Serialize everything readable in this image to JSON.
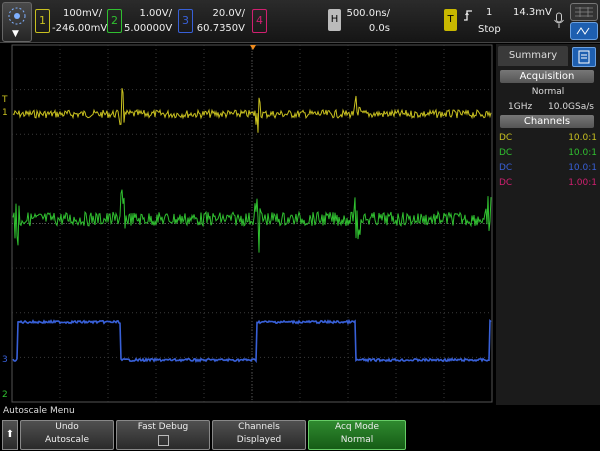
{
  "top": {
    "menu_chevron": "▼",
    "ch1": {
      "num": "1",
      "scale": "100mV/",
      "offset": "-246.00mV",
      "color": "#c8c020"
    },
    "ch2": {
      "num": "2",
      "scale": "1.00V/",
      "offset": "5.00000V",
      "color": "#30c030"
    },
    "ch3": {
      "num": "3",
      "scale": "20.0V/",
      "offset": "60.7350V",
      "color": "#3860d8"
    },
    "ch4": {
      "num": "4",
      "color": "#d02070"
    },
    "horiz": {
      "label": "H",
      "scale": "500.0ns/",
      "delay": "0.0s"
    },
    "trigger": {
      "label": "T",
      "channel": "1",
      "level": "14.3mV",
      "mode": "Stop",
      "edge_icon": "rising-edge"
    }
  },
  "sidebar": {
    "tab": "Summary",
    "acq_header": "Acquisition",
    "acq_mode": "Normal",
    "bandwidth": "1GHz",
    "sample_rate": "10.0GSa/s",
    "channels_header": "Channels",
    "channels": [
      {
        "coupling": "DC",
        "probe": "10.0:1",
        "color": "#c8c020"
      },
      {
        "coupling": "DC",
        "probe": "10.0:1",
        "color": "#30c030"
      },
      {
        "coupling": "DC",
        "probe": "10.0:1",
        "color": "#3860d8"
      },
      {
        "coupling": "DC",
        "probe": "1.00:1",
        "color": "#d02070"
      }
    ]
  },
  "markers": {
    "ch1": "1",
    "ch2": "2",
    "ch3": "3",
    "trig": "T"
  },
  "bottom": {
    "menu_label": "Autoscale Menu",
    "return_glyph": "⬆",
    "undo": [
      "Undo",
      "Autoscale"
    ],
    "fast_debug": "Fast Debug",
    "channels": [
      "Channels",
      "Displayed"
    ],
    "acq_mode": [
      "Acq Mode",
      "Normal"
    ]
  }
}
